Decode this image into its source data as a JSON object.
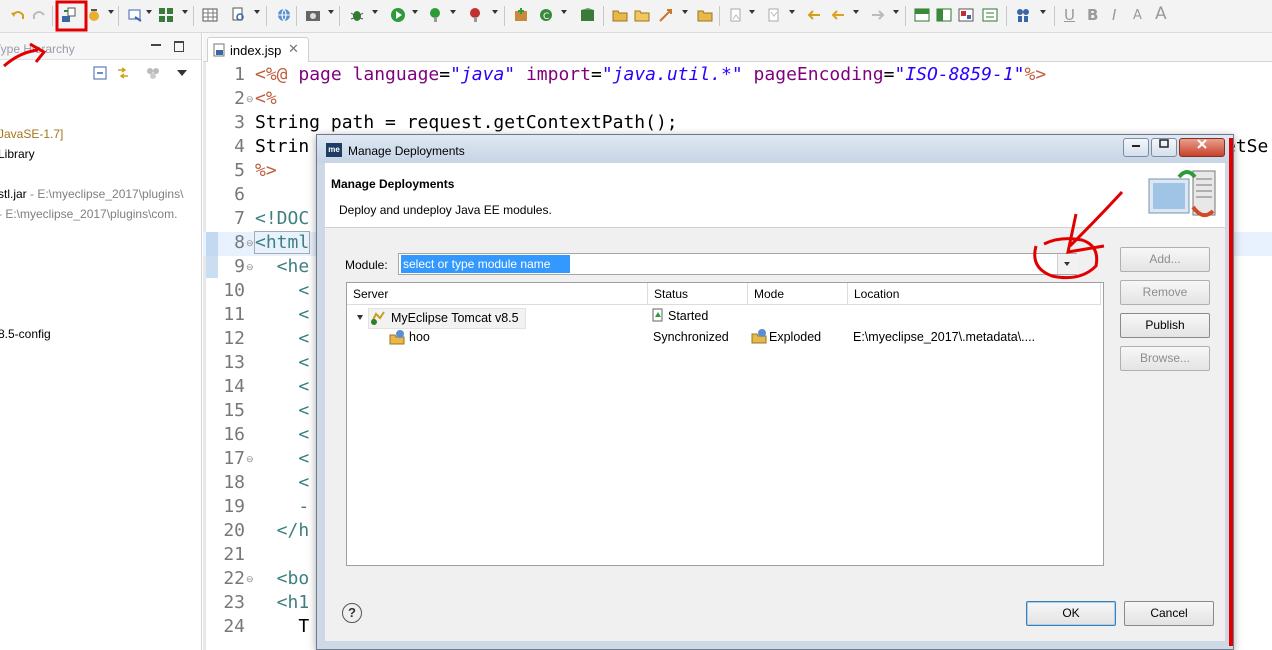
{
  "left_panel": {
    "title": "Type Hierarchy",
    "lines": [
      {
        "text": "JavaSE-1.7]",
        "style": "gold"
      },
      {
        "text": "Library",
        "style": "plain"
      },
      {
        "main": "stl.jar",
        "detail": " - E:\\myeclipse_2017\\plugins\\"
      },
      {
        "main": "",
        "detail": " - E:\\myeclipse_2017\\plugins\\com."
      },
      {
        "text": "8.5-config",
        "style": "plain"
      }
    ]
  },
  "editor": {
    "tab_label": "index.jsp",
    "tab_close": "✕",
    "line_numbers": [
      "1",
      "2",
      "3",
      "4",
      "5",
      "6",
      "7",
      "8",
      "9",
      "10",
      "11",
      "12",
      "13",
      "14",
      "15",
      "16",
      "17",
      "18",
      "19",
      "20",
      "21",
      "22",
      "23",
      "24"
    ],
    "lines": {
      "l1": {
        "open": "<%@ ",
        "page": "page ",
        "a1": "language",
        "eq1": "=",
        "v1": "\"java\"",
        "a2": " import",
        "eq2": "=",
        "v2": "\"java.util.*\"",
        "a3": " pageEncoding",
        "eq3": "=",
        "v3": "\"ISO-8859-1\"",
        "close": "%>"
      },
      "l2": "<%",
      "l3": "String path = request.getContextPath();",
      "l4": "Strin",
      "l4_tail": "etSe",
      "l5": "%>",
      "l7": "<!DOC",
      "l8": "<html",
      "l9": "  <he",
      "l10": "    <",
      "l11": "    <",
      "l12": "    <",
      "l13": "    <",
      "l14": "    <",
      "l15": "    <",
      "l16": "    <",
      "l17": "    <",
      "l18": "    <",
      "l19": "    -",
      "l20": "  </h",
      "l22": "  <bo",
      "l23": "  <h1",
      "l24": "    T"
    }
  },
  "dialog": {
    "title": "Manage Deployments",
    "app_badge": "me",
    "heading": "Manage Deployments",
    "description": "Deploy and undeploy Java EE modules.",
    "module_label": "Module:",
    "module_placeholder": "select or type module name",
    "columns": [
      "Server",
      "Status",
      "Mode",
      "Location"
    ],
    "rows": [
      {
        "server": "MyEclipse Tomcat v8.5",
        "status": "Started",
        "mode": "",
        "location": ""
      },
      {
        "server": "hoo",
        "status": "Synchronized",
        "mode": "Exploded",
        "location": "E:\\myeclipse_2017\\.metadata\\...."
      }
    ],
    "buttons": {
      "add": "Add...",
      "remove": "Remove",
      "publish": "Publish",
      "browse": "Browse...",
      "ok": "OK",
      "cancel": "Cancel"
    },
    "help": "?"
  },
  "toolbar_letters": [
    "U",
    "B",
    "I",
    "A",
    "A"
  ],
  "colors": {
    "accent_selection": "#3399ff",
    "annotation": "#e00000",
    "titlebar": "#c6d4e5"
  }
}
